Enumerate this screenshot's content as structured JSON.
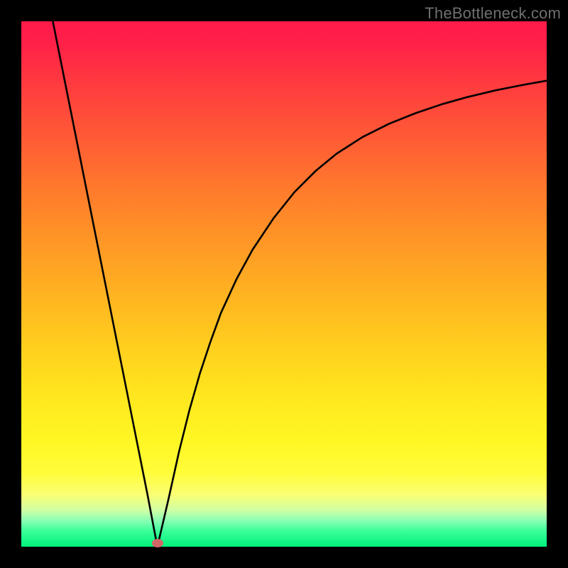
{
  "watermark": "TheBottleneck.com",
  "marker": {
    "x_pct": 25.9,
    "y_pct": 99.3
  },
  "chart_data": {
    "type": "line",
    "title": "",
    "xlabel": "",
    "ylabel": "",
    "xlim": [
      0,
      100
    ],
    "ylim": [
      0,
      100
    ],
    "grid": false,
    "legend": false,
    "annotations": [
      "TheBottleneck.com"
    ],
    "series": [
      {
        "name": "bottleneck-curve",
        "x": [
          6,
          8,
          10,
          12,
          14,
          16,
          18,
          20,
          22,
          24,
          25.9,
          28,
          30,
          32,
          34,
          36,
          38,
          41,
          44,
          48,
          52,
          56,
          60,
          65,
          70,
          75,
          80,
          85,
          90,
          95,
          100
        ],
        "y": [
          100,
          90,
          80,
          70,
          60,
          50,
          40,
          30,
          20,
          10,
          0,
          9,
          18,
          26,
          33,
          39,
          44.5,
          51,
          56.5,
          62.5,
          67.5,
          71.5,
          74.8,
          78,
          80.5,
          82.5,
          84.2,
          85.6,
          86.8,
          87.8,
          88.7
        ]
      }
    ],
    "background_gradient": {
      "type": "vertical",
      "stops": [
        {
          "pct": 0,
          "color": "#ff1a4b"
        },
        {
          "pct": 50,
          "color": "#ffb321"
        },
        {
          "pct": 80,
          "color": "#fff724"
        },
        {
          "pct": 100,
          "color": "#00f27a"
        }
      ]
    },
    "marker_point": {
      "x": 25.9,
      "y": 0
    }
  }
}
